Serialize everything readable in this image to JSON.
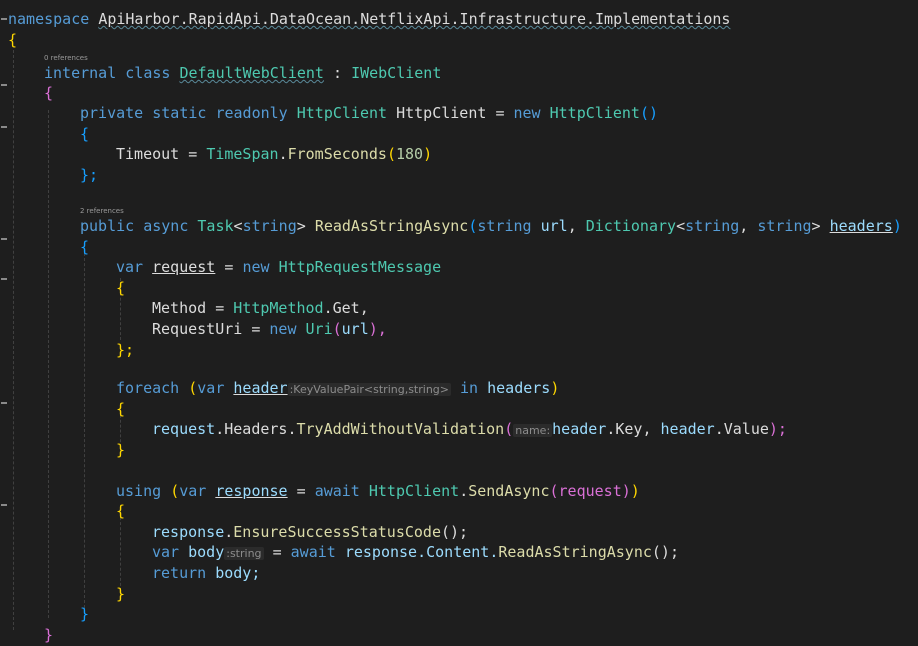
{
  "editor": {
    "codelens": {
      "class_refs": "0 references",
      "method_refs": "2 references"
    },
    "lines": {
      "l1_kw": "namespace",
      "l1_ns": "ApiHarbor.RapidApi.DataOcean.NetflixApi.Infrastructure.Implementations",
      "l2": "{",
      "l3_kw": "internal class",
      "l3_name": "DefaultWebClient",
      "l3_sep": ":",
      "l3_iface": "IWebClient",
      "l4": "{",
      "l5_kw": "private static readonly",
      "l5_type": "HttpClient",
      "l5_name": "HttpClient",
      "l5_eq": "=",
      "l5_new": "new",
      "l5_ctor": "HttpClient",
      "l5_parens": "()",
      "l6": "{",
      "l7_prop": "Timeout",
      "l7_eq": "=",
      "l7_type": "TimeSpan",
      "l7_dot": ".",
      "l7_method": "FromSeconds",
      "l7_open": "(",
      "l7_num": "180",
      "l7_close": ")",
      "l8": "};",
      "l9_kw": "public async",
      "l9_task": "Task",
      "l9_lt": "<",
      "l9_str": "string",
      "l9_gt": ">",
      "l9_method": "ReadAsStringAsync",
      "l9_open": "(",
      "l9_str2": "string",
      "l9_url": "url",
      "l9_comma": ",",
      "l9_dict": "Dictionary",
      "l9_lt2": "<",
      "l9_str3": "string",
      "l9_comma2": ",",
      "l9_str4": "string",
      "l9_gt2": ">",
      "l9_headers": "headers",
      "l9_close": ")",
      "l10": "{",
      "l11_var": "var",
      "l11_name": "request",
      "l11_eq": "=",
      "l11_new": "new",
      "l11_type": "HttpRequestMessage",
      "l12": "{",
      "l13_prop": "Method",
      "l13_eq": "=",
      "l13_type": "HttpMethod",
      "l13_rest": ".Get,",
      "l14_prop": "RequestUri",
      "l14_eq": "=",
      "l14_new": "new",
      "l14_type": "Uri",
      "l14_open": "(",
      "l14_arg": "url",
      "l14_close": "),",
      "l15": "};",
      "l16_kw": "foreach",
      "l16_open": "(",
      "l16_var": "var",
      "l16_name": "header",
      "l16_hint": ":KeyValuePair<string,string>",
      "l16_in": "in",
      "l16_headers": "headers",
      "l16_close": ")",
      "l17": "{",
      "l18_obj": "request",
      "l18_mid": ".Headers.",
      "l18_method": "TryAddWithoutValidation",
      "l18_open": "(",
      "l18_hint": "name:",
      "l18_a1": "header",
      "l18_k": ".Key, ",
      "l18_a2": "header",
      "l18_v": ".Value",
      "l18_close": ");",
      "l19": "}",
      "l20_kw": "using",
      "l20_open": "(",
      "l20_var": "var",
      "l20_name": "response",
      "l20_eq": "=",
      "l20_await": "await",
      "l20_type": "HttpClient",
      "l20_dot": ".",
      "l20_method": "SendAsync",
      "l20_args": "(request)",
      "l20_close": ")",
      "l21": "{",
      "l22_obj": "response",
      "l22_dot": ".",
      "l22_method": "EnsureSuccessStatusCode",
      "l22_rest": "();",
      "l23_var": "var",
      "l23_name": "body",
      "l23_hint": ":string",
      "l23_eq": "=",
      "l23_await": "await",
      "l23_obj": "response.Content.",
      "l23_method": "ReadAsStringAsync",
      "l23_rest": "();",
      "l24_kw": "return",
      "l24_rest": "body;",
      "l25": "}",
      "l26": "}",
      "l27": "}"
    }
  }
}
